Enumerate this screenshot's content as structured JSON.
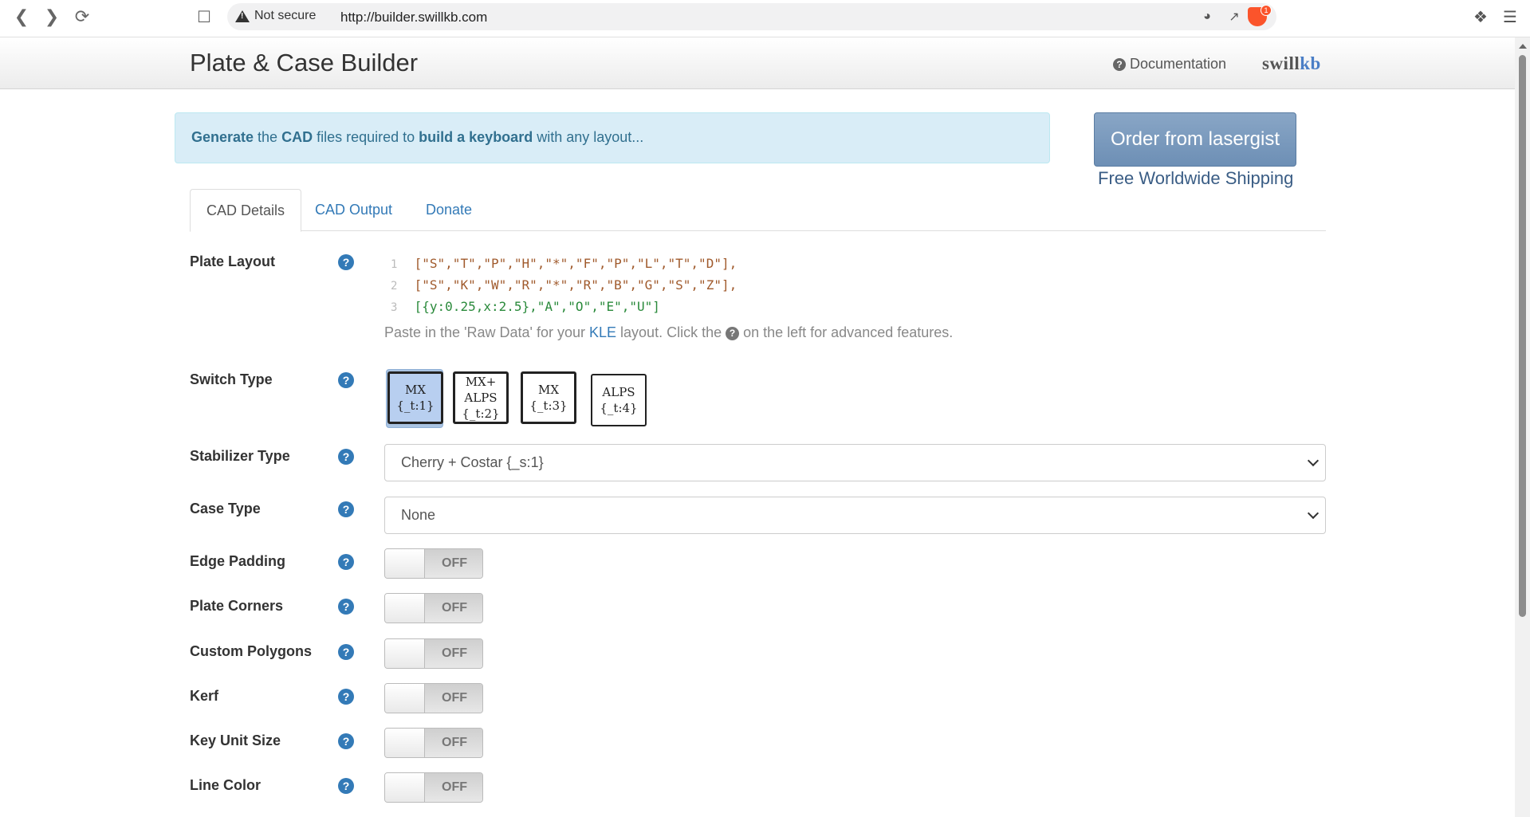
{
  "browser": {
    "security_label": "Not secure",
    "url": "http://builder.swillkb.com",
    "shield_badge": "1"
  },
  "navbar": {
    "title": "Plate & Case Builder",
    "documentation": "Documentation",
    "logo_main": "swill",
    "logo_accent": "kb"
  },
  "alert": {
    "w1": "Generate",
    "w2": " the ",
    "w3": "CAD",
    "w4": " files required to ",
    "w5": "build a keyboard",
    "w6": " with any layout..."
  },
  "order": {
    "button": "Order from lasergist",
    "shipping": "Free Worldwide Shipping"
  },
  "tabs": [
    "CAD Details",
    "CAD Output",
    "Donate"
  ],
  "plate_layout": {
    "label": "Plate Layout",
    "lines": [
      "[\"S\",\"T\",\"P\",\"H\",\"*\",\"F\",\"P\",\"L\",\"T\",\"D\"],",
      "[\"S\",\"K\",\"W\",\"R\",\"*\",\"R\",\"B\",\"G\",\"S\",\"Z\"],",
      "[{y:0.25,x:2.5},\"A\",\"O\",\"E\",\"U\"]"
    ],
    "hint_pre": "Paste in the 'Raw Data' for your ",
    "hint_link": "KLE",
    "hint_mid": " layout. Click the ",
    "hint_post": " on the left for advanced features."
  },
  "switch_type": {
    "label": "Switch Type",
    "options": [
      {
        "l1": "MX",
        "l2": "{_t:1}",
        "l3": ""
      },
      {
        "l1": "MX+",
        "l2": "ALPS",
        "l3": "{_t:2}"
      },
      {
        "l1": "MX",
        "l2": "{_t:3}",
        "l3": ""
      },
      {
        "l1": "ALPS",
        "l2": "{_t:4}",
        "l3": ""
      }
    ]
  },
  "stabilizer": {
    "label": "Stabilizer Type",
    "value": "Cherry + Costar {_s:1}"
  },
  "case": {
    "label": "Case Type",
    "value": "None"
  },
  "toggles": [
    {
      "label": "Edge Padding",
      "state": "OFF"
    },
    {
      "label": "Plate Corners",
      "state": "OFF"
    },
    {
      "label": "Custom Polygons",
      "state": "OFF"
    },
    {
      "label": "Kerf",
      "state": "OFF"
    },
    {
      "label": "Key Unit Size",
      "state": "OFF"
    },
    {
      "label": "Line Color",
      "state": "OFF"
    }
  ],
  "colors": {
    "link": "#337ab7",
    "alert_bg": "#d9edf7",
    "order_btn": "#7a9abd"
  }
}
